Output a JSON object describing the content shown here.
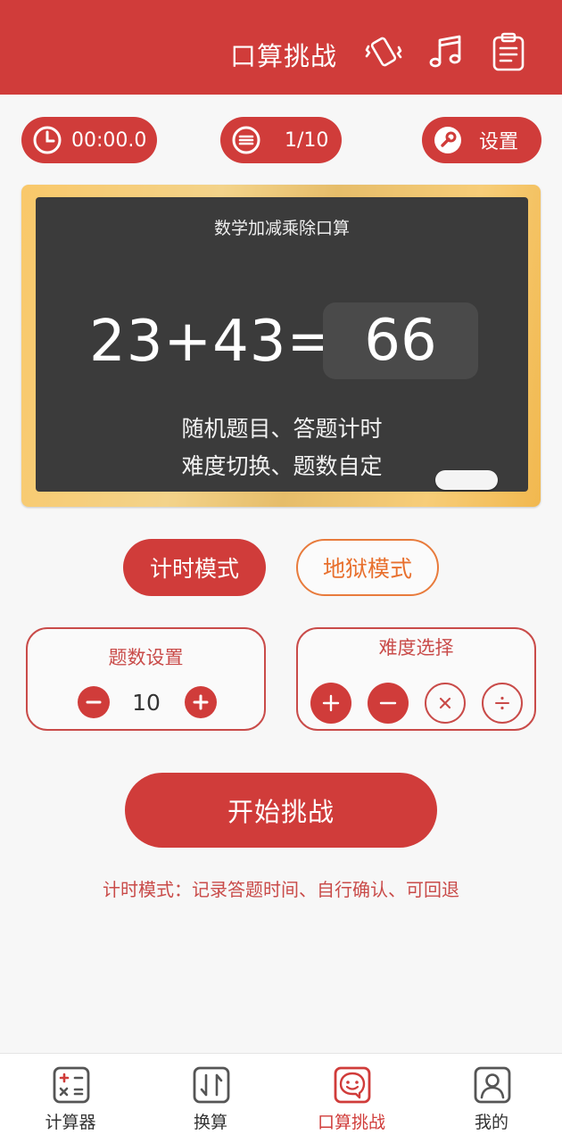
{
  "header": {
    "title": "口算挑战",
    "icons": [
      "vibrate-icon",
      "music-icon",
      "clipboard-icon"
    ]
  },
  "toolbar": {
    "timer": "00:00.0",
    "progress": "1/10",
    "settings_label": "设置"
  },
  "board": {
    "title": "数学加减乘除口算",
    "equation": "23+43=",
    "answer": "66",
    "line1": "随机题目、答题计时",
    "line2": "难度切换、题数自定"
  },
  "modes": {
    "timed": "计时模式",
    "hell": "地狱模式"
  },
  "question_count": {
    "title": "题数设置",
    "value": "10"
  },
  "difficulty": {
    "title": "难度选择",
    "ops": [
      {
        "symbol": "+",
        "selected": true
      },
      {
        "symbol": "−",
        "selected": true
      },
      {
        "symbol": "×",
        "selected": false
      },
      {
        "symbol": "÷",
        "selected": false
      }
    ]
  },
  "start_button": "开始挑战",
  "hint": "计时模式：记录答题时间、自行确认、可回退",
  "nav": [
    {
      "label": "计算器",
      "icon": "calculator-icon",
      "active": false
    },
    {
      "label": "换算",
      "icon": "convert-icon",
      "active": false
    },
    {
      "label": "口算挑战",
      "icon": "chat-smile-icon",
      "active": true
    },
    {
      "label": "我的",
      "icon": "profile-icon",
      "active": false
    }
  ],
  "colors": {
    "primary": "#d03c3a",
    "accent_orange": "#e8702e",
    "board": "#3b3b3b",
    "frame": "#f3c56f"
  }
}
